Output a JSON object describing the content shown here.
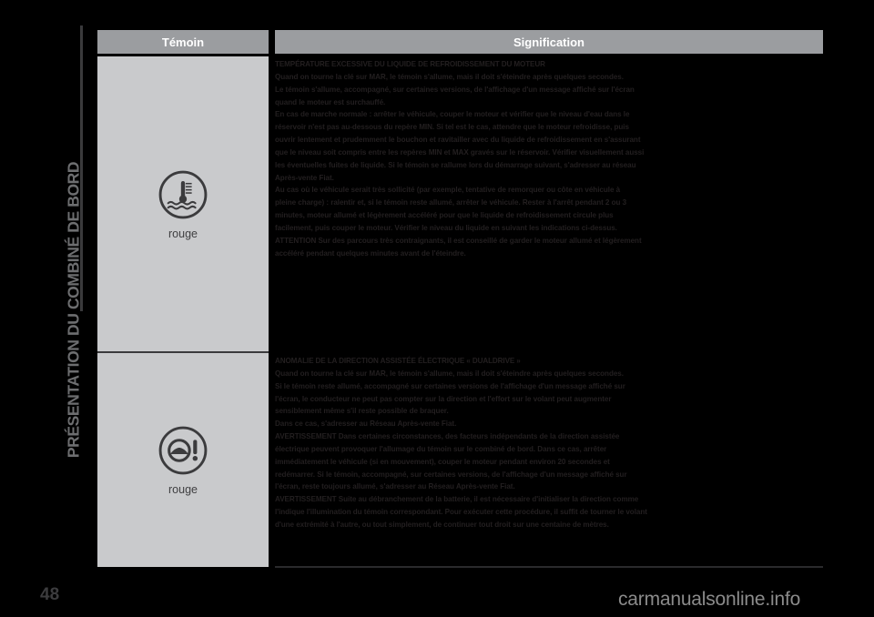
{
  "chapter_title": "PRÉSENTATION DU COMBINÉ DE BORD",
  "page_number": "48",
  "watermark": "carmanualsonline.info",
  "table": {
    "headers": {
      "temoin": "Témoin",
      "signification": "Signification"
    },
    "rows": [
      {
        "icon": "coolant-temperature-warning-icon",
        "color_label": "rouge",
        "lines": [
          "TEMPÉRATURE EXCESSIVE DU LIQUIDE DE REFROIDISSEMENT DU MOTEUR",
          "Quand on tourne la clé sur MAR, le témoin s'allume, mais il doit s'éteindre après quelques secondes.",
          "Le témoin s'allume, accompagné, sur certaines versions, de l'affichage d'un message affiché sur l'écran",
          "quand le moteur est surchauffé.",
          "En cas de marche normale : arrêter le véhicule, couper le moteur et vérifier que le niveau d'eau dans le",
          "réservoir n'est pas au-dessous du repère MIN. Si tel est le cas, attendre que le moteur refroidisse, puis",
          "ouvrir lentement et prudemment le bouchon et ravitailler avec du liquide de refroidissement en s'assurant",
          "que le niveau soit compris entre les repères MIN et MAX gravés sur le réservoir. Vérifier visuellement aussi",
          "les éventuelles fuites de liquide. Si le témoin se rallume lors du démarrage suivant, s'adresser au réseau",
          "Après-vente Fiat.",
          "Au cas où le véhicule serait très sollicité (par exemple, tentative de remorquer ou côte en véhicule à",
          "pleine charge) : ralentir et, si le témoin reste allumé, arrêter le véhicule. Rester à l'arrêt pendant 2 ou 3",
          "minutes, moteur allumé et légèrement accéléré pour que le liquide de refroidissement circule plus",
          "facilement, puis couper le moteur. Vérifier le niveau du liquide en suivant les indications ci-dessus.",
          "ATTENTION Sur des parcours très contraignants, il est conseillé de garder le moteur allumé et légèrement",
          "accéléré pendant quelques minutes avant de l'éteindre."
        ]
      },
      {
        "icon": "electric-power-steering-warning-icon",
        "color_label": "rouge",
        "lines": [
          "ANOMALIE DE LA DIRECTION ASSISTÉE ÉLECTRIQUE « DUALDRIVE »",
          "Quand on tourne la clé sur MAR, le témoin s'allume, mais il doit s'éteindre après quelques secondes.",
          "Si le témoin reste allumé, accompagné sur certaines versions de l'affichage d'un message affiché sur",
          "l'écran, le conducteur ne peut pas compter sur la direction et l'effort sur le volant peut augmenter",
          "sensiblement même s'il reste possible de braquer.",
          "Dans ce cas, s'adresser au Réseau Après-vente Fiat.",
          "AVERTISSEMENT Dans certaines circonstances, des facteurs indépendants de la direction assistée",
          "électrique peuvent provoquer l'allumage du témoin sur le combiné de bord. Dans ce cas, arrêter",
          "immédiatement le véhicule (si en mouvement), couper le moteur pendant environ 20 secondes et",
          "redémarrer. Si le témoin, accompagné, sur certaines versions, de l'affichage d'un message affiché sur",
          "l'écran, reste toujours allumé, s'adresser au Réseau Après-vente Fiat.",
          "AVERTISSEMENT Suite au débranchement de la batterie, il est nécessaire d'initialiser la direction comme",
          "l'indique l'illumination du témoin correspondant. Pour exécuter cette procédure, il suffit de tourner le volant",
          "d'une extrémité à l'autre, ou tout simplement, de continuer tout droit sur une centaine de mètres."
        ]
      }
    ]
  },
  "colors": {
    "page_background": "#000000",
    "header_bar": "#9b9da0",
    "temoin_cell": "#c9cacc",
    "body_text": "#231f20",
    "side_title": "#6d6e70"
  }
}
